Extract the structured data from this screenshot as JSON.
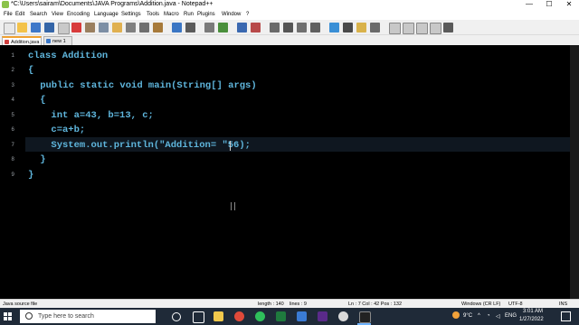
{
  "window": {
    "title": "*C:\\Users\\sairam\\Documents\\JAVA Programs\\Addition.java - Notepad++",
    "minimize": "—",
    "maximize": "☐",
    "close": "✕"
  },
  "menu": [
    "File",
    "Edit",
    "Search",
    "View",
    "Encoding",
    "Language",
    "Settings",
    "Tools",
    "Macro",
    "Run",
    "Plugins",
    "Window",
    "?"
  ],
  "toolbar_icons": [
    "new-icon",
    "open-icon",
    "save-icon",
    "save-all-icon",
    "close-icon",
    "close-all-icon",
    "print-icon",
    "cut-icon",
    "copy-icon",
    "paste-icon",
    "undo-icon",
    "redo-icon",
    "find-icon",
    "replace-icon",
    "zoom-in-icon",
    "zoom-out-icon",
    "sync-v-icon",
    "sync-h-icon",
    "wrap-icon",
    "show-all-icon",
    "indent-guide-icon",
    "udl-icon",
    "doc-map-icon",
    "function-list-icon",
    "folder-workspace-icon",
    "monitor-icon",
    "record-icon",
    "stop-icon",
    "play-icon",
    "play-multi-icon",
    "save-macro-icon"
  ],
  "tabs": [
    {
      "label": "Addition.java",
      "active": true
    },
    {
      "label": "new 1",
      "active": false
    }
  ],
  "code_lines": [
    "class Addition",
    "{",
    "    public static void main(String[] args)",
    "    {",
    "        int a=43, b=13, c;",
    "        c=a+b;",
    "        System.out.println(\"Addition= \"56);",
    "    }",
    "}"
  ],
  "line_numbers": [
    "1",
    "2",
    "3",
    "4",
    "5",
    "6",
    "7",
    "8",
    "9"
  ],
  "status": {
    "file_type": "Java source file",
    "length": "length : 140",
    "lines": "lines : 9",
    "position": "Ln : 7    Col : 42    Pos : 132",
    "eol": "Windows (CR LF)",
    "encoding": "UTF-8",
    "mode": "INS"
  },
  "taskbar": {
    "search_placeholder": "Type here to search",
    "weather": "9°C",
    "time": "3:01 AM",
    "date": "1/27/2022",
    "lang": "ENG"
  },
  "colors": {
    "editor_bg": "#000000",
    "code_fg": "#5fb6dd",
    "taskbar_bg": "#1f2a38"
  }
}
